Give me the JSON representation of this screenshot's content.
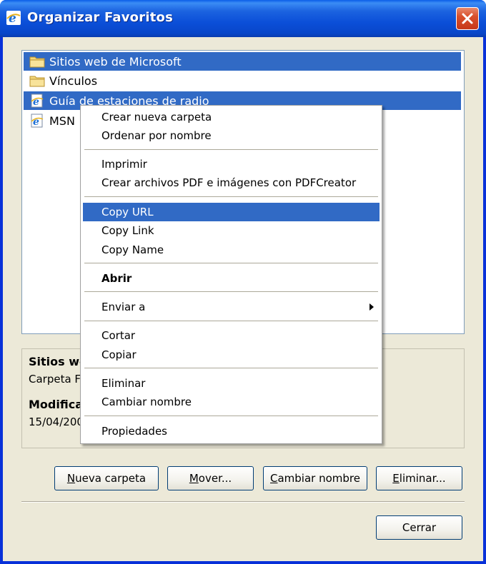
{
  "window": {
    "title": "Organizar Favoritos",
    "close_icon": "close-icon",
    "app_icon": "ie-icon",
    "colors": {
      "titlebar": "#0b4fd8",
      "selection": "#316ac5",
      "client": "#ece9d8",
      "close": "#d9502c"
    }
  },
  "favorites": {
    "items": [
      {
        "label": "Sitios web de Microsoft",
        "icon": "folder-icon",
        "selected": true
      },
      {
        "label": "Vínculos",
        "icon": "folder-icon",
        "selected": false
      },
      {
        "label": "Guía de estaciones de radio",
        "icon": "ie-page-icon",
        "selected": true
      },
      {
        "label": "MSN",
        "icon": "ie-page-icon",
        "selected": false
      }
    ]
  },
  "details": {
    "name": "Sitios we",
    "type": "Carpeta F",
    "modified_label": "Modifica",
    "modified_value": "15/04/200"
  },
  "buttons": {
    "new_folder": {
      "accel": "N",
      "rest": "ueva carpeta"
    },
    "move": {
      "accel": "M",
      "rest": "over..."
    },
    "rename": {
      "accel": "C",
      "rest": "ambiar nombre"
    },
    "delete": {
      "accel": "E",
      "rest": "liminar..."
    },
    "close": "Cerrar"
  },
  "context_menu": {
    "items": [
      {
        "label": "Crear nueva carpeta"
      },
      {
        "label": "Ordenar por nombre"
      },
      {
        "label": "Imprimir"
      },
      {
        "label": "Crear archivos PDF e imágenes con PDFCreator"
      },
      {
        "label": "Copy URL",
        "highlighted": true
      },
      {
        "label": "Copy Link"
      },
      {
        "label": "Copy Name"
      },
      {
        "label": "Abrir",
        "bold": true
      },
      {
        "label": "Enviar a",
        "submenu": true
      },
      {
        "label": "Cortar"
      },
      {
        "label": "Copiar"
      },
      {
        "label": "Eliminar"
      },
      {
        "label": "Cambiar nombre"
      },
      {
        "label": "Propiedades"
      }
    ]
  }
}
